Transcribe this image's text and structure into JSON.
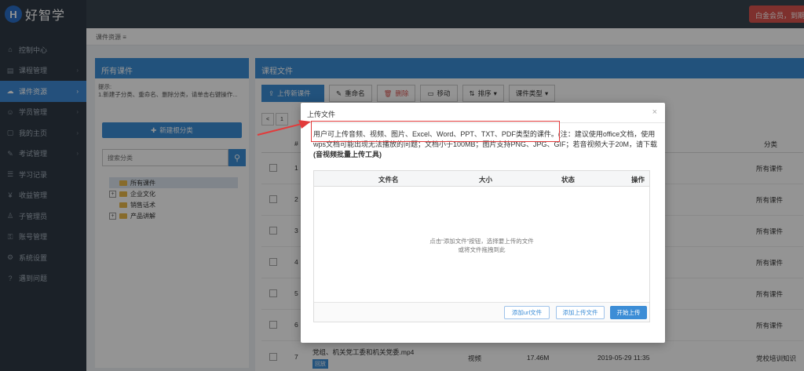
{
  "app": {
    "logo_letter": "H",
    "logo_text": "好智学",
    "member_badge": "白金会员，到期"
  },
  "sidebar": {
    "items": [
      {
        "label": "控制中心",
        "icon": "home-icon",
        "active": false,
        "arrow": false
      },
      {
        "label": "课程管理",
        "icon": "book-icon",
        "active": false,
        "arrow": true
      },
      {
        "label": "课件资源",
        "icon": "cloud-icon",
        "active": true,
        "arrow": true
      },
      {
        "label": "学员管理",
        "icon": "user-icon",
        "active": false,
        "arrow": true
      },
      {
        "label": "我的主页",
        "icon": "page-icon",
        "active": false,
        "arrow": true
      },
      {
        "label": "考试管理",
        "icon": "exam-icon",
        "active": false,
        "arrow": true
      },
      {
        "label": "学习记录",
        "icon": "record-icon",
        "active": false,
        "arrow": false
      },
      {
        "label": "收益管理",
        "icon": "money-icon",
        "active": false,
        "arrow": false
      },
      {
        "label": "子管理员",
        "icon": "admin-icon",
        "active": false,
        "arrow": false
      },
      {
        "label": "账号管理",
        "icon": "account-icon",
        "active": false,
        "arrow": false
      },
      {
        "label": "系统设置",
        "icon": "gear-icon",
        "active": false,
        "arrow": false
      },
      {
        "label": "遇到问题",
        "icon": "help-icon",
        "active": false,
        "arrow": false
      }
    ]
  },
  "breadcrumb": {
    "text": "课件资源 ≡"
  },
  "left_panel": {
    "title": "所有课件",
    "tip_line1": "提示:",
    "tip_line2": "1.新建子分类、重命名、删除分类，请单击右键操作...",
    "new_category_label": "新建根分类",
    "search_placeholder": "搜索分类",
    "tree": [
      {
        "label": "所有课件",
        "expandable": false,
        "selected": true
      },
      {
        "label": "企业文化",
        "expandable": true,
        "selected": false
      },
      {
        "label": "销售话术",
        "expandable": false,
        "selected": false
      },
      {
        "label": "产品讲解",
        "expandable": true,
        "selected": false
      }
    ]
  },
  "right_panel": {
    "title": "课程文件",
    "toolbar": {
      "upload": "上传新课件",
      "rename": "重命名",
      "delete": "删除",
      "move": "移动",
      "sort": "排序",
      "type": "课件类型"
    },
    "pager": [
      "<",
      "1"
    ],
    "header_hash": "#",
    "header_category": "分类",
    "rows": [
      {
        "num": "1",
        "category": "所有课件"
      },
      {
        "num": "2",
        "category": "所有课件"
      },
      {
        "num": "3",
        "category": "所有课件"
      },
      {
        "num": "4",
        "category": "所有课件"
      },
      {
        "num": "5",
        "category": "所有课件"
      },
      {
        "num": "6",
        "category": "所有课件"
      }
    ],
    "last_row": {
      "num": "7",
      "name": "党组、机关党工委和机关党委.mp4",
      "tag": "回放",
      "type": "视频",
      "size": "17.46M",
      "date": "2019-05-29 11:35",
      "category": "党校培训知识"
    }
  },
  "modal": {
    "title": "上传文件",
    "close": "×",
    "notice_main": "用户可上传音频、视频、图片、Excel、Word、PPT、TXT、PDF类型的课件。",
    "notice_note": "(注：建议使用office文档，使用wps文档可能出现无法播放的问题；文档小于100MB；图片支持PNG、JPG、GIF；若音视频大于20M，请下载",
    "notice_bold": "(音视频批量上传工具)",
    "columns": [
      "文件名",
      "大小",
      "状态",
      "操作"
    ],
    "empty_line1": "点击“添加文件”按钮，选择要上传的文件",
    "empty_line2": "或将文件拖拽到此",
    "btn_add_url": "添加url文件",
    "btn_add_file": "添加上传文件",
    "btn_start": "开始上传"
  },
  "colors": {
    "accent": "#3c8dd6",
    "annotation": "#e23b3b",
    "sidebar": "#2f3a45"
  }
}
